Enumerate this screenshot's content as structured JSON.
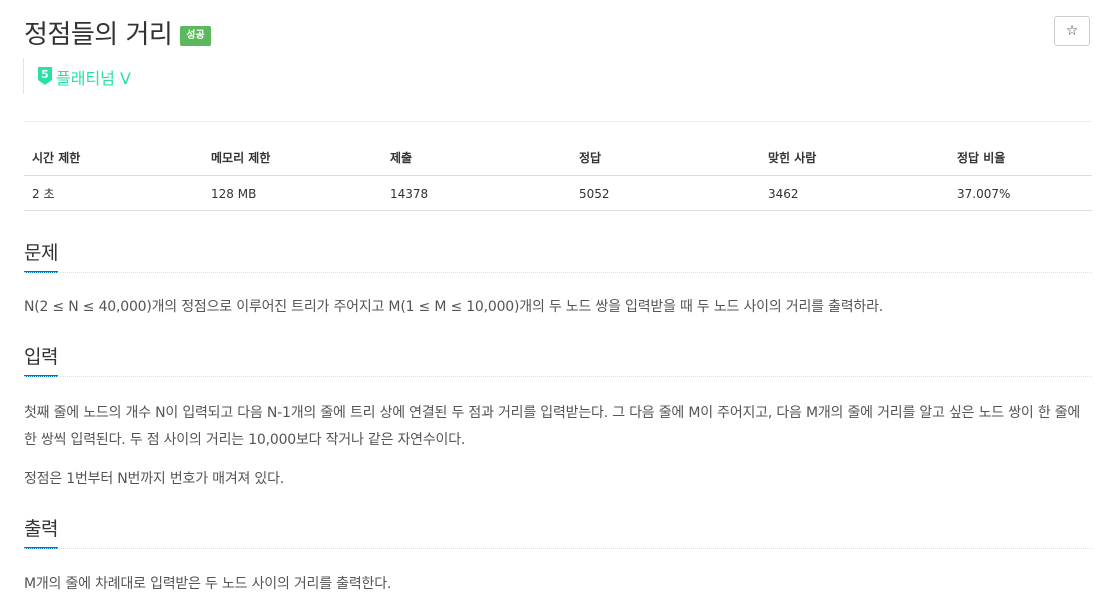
{
  "problem": {
    "title": "정점들의 거리",
    "status_badge": "성공",
    "favorite_icon": "☆",
    "tier": {
      "number": "5",
      "label": "플래티넘 V",
      "color": "#27e2a4",
      "icon": "platinum-tier-icon"
    }
  },
  "stats_table": {
    "headers": [
      "시간 제한",
      "메모리 제한",
      "제출",
      "정답",
      "맞힌 사람",
      "정답 비율"
    ],
    "values": [
      "2 초",
      "128 MB",
      "14378",
      "5052",
      "3462",
      "37.007%"
    ]
  },
  "sections": {
    "problem": {
      "heading": "문제",
      "paragraphs": [
        "N(2 ≤ N ≤ 40,000)개의 정점으로 이루어진 트리가 주어지고 M(1 ≤ M ≤ 10,000)개의 두 노드 쌍을 입력받을 때 두 노드 사이의 거리를 출력하라."
      ]
    },
    "input": {
      "heading": "입력",
      "paragraphs": [
        "첫째 줄에 노드의 개수 N이 입력되고 다음 N-1개의 줄에 트리 상에 연결된 두 점과 거리를 입력받는다. 그 다음 줄에 M이 주어지고, 다음 M개의 줄에 거리를 알고 싶은 노드 쌍이 한 줄에 한 쌍씩 입력된다. 두 점 사이의 거리는 10,000보다 작거나 같은 자연수이다.",
        "정점은 1번부터 N번까지 번호가 매겨져 있다."
      ]
    },
    "output": {
      "heading": "출력",
      "paragraphs": [
        "M개의 줄에 차례대로 입력받은 두 노드 사이의 거리를 출력한다."
      ]
    }
  },
  "colors": {
    "success_badge": "#5cb85c",
    "section_underline": "#0076c0"
  }
}
